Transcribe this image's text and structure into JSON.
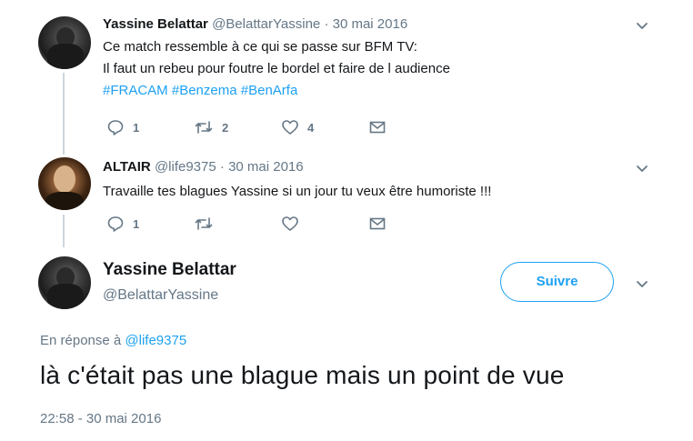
{
  "tweet1": {
    "name": "Yassine Belattar",
    "handle": "@BelattarYassine",
    "separator": "·",
    "date": "30 mai 2016",
    "line1": "Ce match ressemble à ce qui se passe sur BFM TV:",
    "line2": "Il faut un rebeu pour foutre le bordel et faire de l audience",
    "hashtags": [
      "#FRACAM",
      "#Benzema",
      "#BenArfa"
    ],
    "actions": {
      "reply_count": "1",
      "retweet_count": "2",
      "like_count": "4"
    }
  },
  "tweet2": {
    "name": "ALTAIR",
    "handle": "@life9375",
    "separator": "·",
    "date": "30 mai 2016",
    "text": "Travaille tes blagues Yassine si un jour tu veux être humoriste !!!",
    "actions": {
      "reply_count": "1"
    }
  },
  "main_tweet": {
    "name": "Yassine Belattar",
    "handle": "@BelattarYassine",
    "follow_label": "Suivre",
    "reply_prefix": "En réponse à",
    "reply_mention": "@life9375",
    "text": "là c'était pas une blague mais un point de vue",
    "timestamp": "22:58 - 30 mai 2016"
  },
  "icons": {
    "reply": "reply-icon",
    "retweet": "retweet-icon",
    "like": "heart-icon",
    "message": "envelope-icon",
    "more": "chevron-down-icon"
  },
  "colors": {
    "link": "#1da1f2",
    "secondary": "#657786",
    "text": "#14171a",
    "thread": "#ccd6dd"
  }
}
